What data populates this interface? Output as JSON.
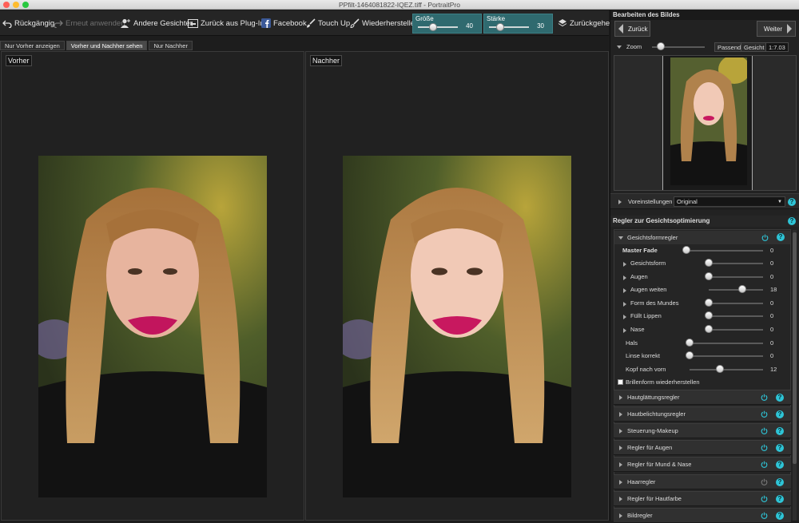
{
  "window": {
    "title": "PPfilt-1464081822-IQEZ.tiff - PortraitPro"
  },
  "toolbar": {
    "undo": "Rückgängig",
    "redo": "Erneut anwenden",
    "other_faces": "Andere Gesichter",
    "back_plugin": "Zurück aus Plug-In",
    "facebook": "Facebook",
    "touchup": "Touch Up",
    "restore": "Wiederherstellen",
    "size_label": "Größe",
    "size_value": "40",
    "strength_label": "Stärke",
    "strength_value": "30",
    "reset": "Zurückgehen"
  },
  "view_tabs": [
    {
      "label": "Nur Vorher anzeigen",
      "active": false
    },
    {
      "label": "Vorher und Nachher sehen",
      "active": true
    },
    {
      "label": "Nur Nachher",
      "active": false
    }
  ],
  "panes": {
    "before": "Vorher",
    "after": "Nachher"
  },
  "right_panel": {
    "header": "Bearbeiten des Bildes",
    "back": "Zurück",
    "next": "Weiter",
    "zoom_label": "Zoom",
    "fit": "Passend",
    "face": "Gesicht",
    "zoom_value": "1:7.03",
    "presets_label": "Voreinstellungen",
    "presets_value": "Original",
    "face_section": "Regler zur Gesichtsoptimierung",
    "shape_group": "Gesichtsformregler",
    "master_fade": {
      "label": "Master Fade",
      "value": "0",
      "level": 0
    },
    "sliders": [
      {
        "label": "Gesichtsform",
        "value": "0",
        "expand": true,
        "level": 0
      },
      {
        "label": "Augen",
        "value": "0",
        "expand": true,
        "level": 0
      },
      {
        "label": "Augen weiten",
        "value": "18",
        "expand": true,
        "level": 0.18
      },
      {
        "label": "Form des Mundes",
        "value": "0",
        "expand": true,
        "level": 0
      },
      {
        "label": "Füllt Lippen",
        "value": "0",
        "expand": true,
        "level": 0
      },
      {
        "label": "Nase",
        "value": "0",
        "expand": true,
        "level": 0
      },
      {
        "label": "Hals",
        "value": "0",
        "expand": false,
        "level": 0
      },
      {
        "label": "Linse korrekt",
        "value": "0",
        "expand": false,
        "level": 0
      },
      {
        "label": "Kopf nach vorn",
        "value": "12",
        "expand": false,
        "level": 0.12
      }
    ],
    "glasses": "Brillenform wiederherstellen",
    "sections": [
      {
        "label": "Hautglättungsregler",
        "on": true
      },
      {
        "label": "Hautbelichtungsregler",
        "on": true
      },
      {
        "label": "Steuerung-Makeup",
        "on": true
      },
      {
        "label": "Regler für Augen",
        "on": true
      },
      {
        "label": "Regler für Mund & Nase",
        "on": true
      },
      {
        "label": "Haarregler",
        "on": false
      },
      {
        "label": "Regler für Hautfarbe",
        "on": true
      },
      {
        "label": "Bildregler",
        "on": true
      }
    ]
  },
  "colors": {
    "accent": "#2ec4d6",
    "slider_box": "#2f6a6f",
    "power_on": "#2ec4d6",
    "power_off": "#777777"
  }
}
